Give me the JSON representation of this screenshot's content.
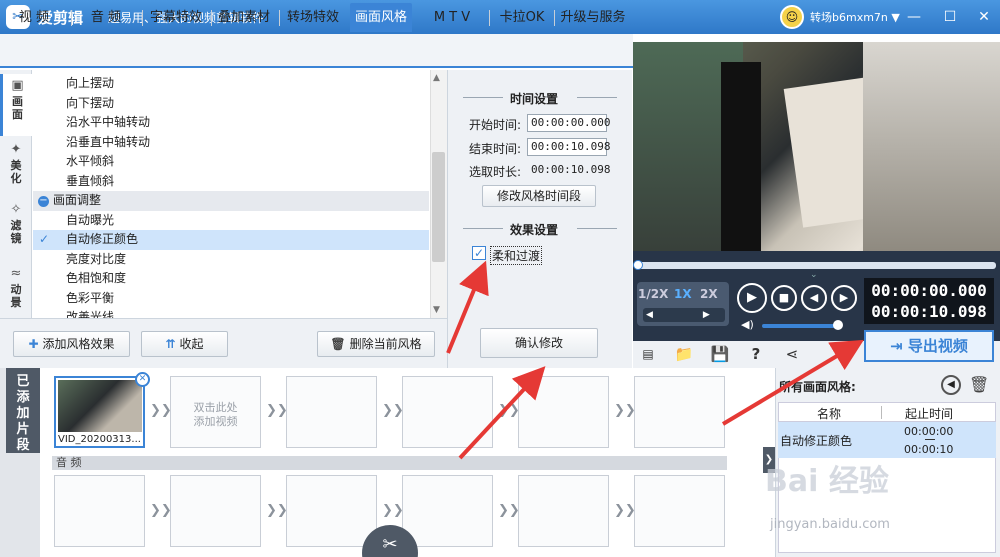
{
  "app": {
    "logo_glyph": "✂",
    "title": "爱剪辑",
    "slogan": "超易用、强大的视频剪辑软件",
    "username": "转场b6mxm7n ▼"
  },
  "window": {
    "minimize": "—",
    "maximize": "☐",
    "close": "✕"
  },
  "tabs": [
    "视  频",
    "音  频",
    "字幕特效",
    "叠加素材",
    "转场特效",
    "画面风格",
    "M T V",
    "卡拉OK",
    "升级与服务"
  ],
  "active_tab": "画面风格",
  "sidebar": [
    {
      "label": "画面",
      "icon": "▣",
      "active": true
    },
    {
      "label": "美化",
      "icon": "✦",
      "active": false
    },
    {
      "label": "滤镜",
      "icon": "✧",
      "active": false
    },
    {
      "label": "动景",
      "icon": "≈",
      "active": false
    }
  ],
  "effect_list": {
    "items_before": [
      "向上摆动",
      "向下摆动",
      "沿水平中轴转动",
      "沿垂直中轴转动",
      "水平倾斜",
      "垂直倾斜"
    ],
    "category": "画面调整",
    "item_a": "自动曝光",
    "selected": "自动修正颜色",
    "items_after": [
      "亮度对比度",
      "色相饱和度",
      "色彩平衡",
      "改善光线"
    ]
  },
  "list_toolbar": {
    "add": "添加风格效果",
    "collapse": "收起",
    "delete": "删除当前风格"
  },
  "time_settings": {
    "title": "时间设置",
    "start_label": "开始时间:",
    "start_value": "00:00:00.000",
    "end_label": "结束时间:",
    "end_value": "00:00:10.098",
    "duration_label": "选取时长:",
    "duration_value": "00:00:10.098",
    "modify_button": "修改风格时间段"
  },
  "effect_settings": {
    "title": "效果设置",
    "soft_transition": "柔和过渡",
    "checked_mark": "✓",
    "confirm_button": "确认修改"
  },
  "player": {
    "speeds": [
      "1/2X",
      "1X",
      "2X"
    ],
    "current_time": "00:00:00.000",
    "total_time": "00:00:10.098",
    "progress": 0.0,
    "volume": 0.85
  },
  "export_label": "导出视频",
  "timeline": {
    "tab_label": [
      "已",
      "添",
      "加",
      "片",
      "段"
    ],
    "clip_name": "VID_20200313...",
    "add_hint_1": "双击此处",
    "add_hint_2": "添加视频",
    "audio_label": "音 频"
  },
  "style_panel": {
    "title": "所有画面风格:",
    "col_name": "名称",
    "col_time": "起止时间",
    "row_name": "自动修正颜色",
    "row_start": "00:00:00",
    "row_end": "00:00:10"
  },
  "watermark": {
    "text": "Bai 经验",
    "url": "jingyan.baidu.com"
  },
  "colors": {
    "accent": "#3b84d6",
    "annotation": "#e53935"
  }
}
